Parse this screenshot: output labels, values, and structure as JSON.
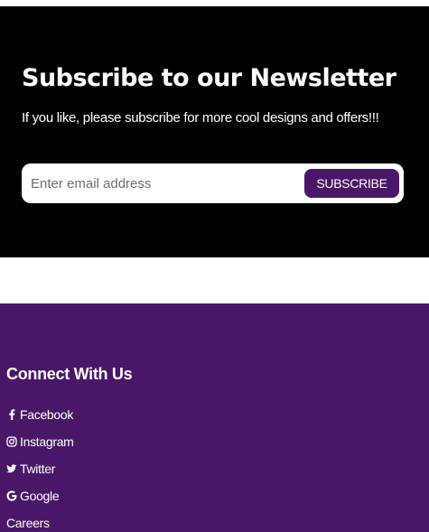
{
  "newsletter": {
    "title": "Subscribe to our Newsletter",
    "subtitle": "If you like, please subscribe for more cool designs and offers!!!",
    "email_placeholder": "Enter email address",
    "subscribe_label": "SUBSCRIBE"
  },
  "footer": {
    "heading": "Connect With Us",
    "links": [
      {
        "label": "Facebook",
        "icon": "facebook-icon"
      },
      {
        "label": "Instagram",
        "icon": "instagram-icon"
      },
      {
        "label": "Twitter",
        "icon": "twitter-icon"
      },
      {
        "label": "Google",
        "icon": "google-icon"
      },
      {
        "label": "Careers",
        "icon": ""
      }
    ]
  },
  "colors": {
    "newsletter_bg": "#000000",
    "footer_bg": "#4a1768",
    "accent": "#4a1768",
    "text": "#ffffff"
  }
}
